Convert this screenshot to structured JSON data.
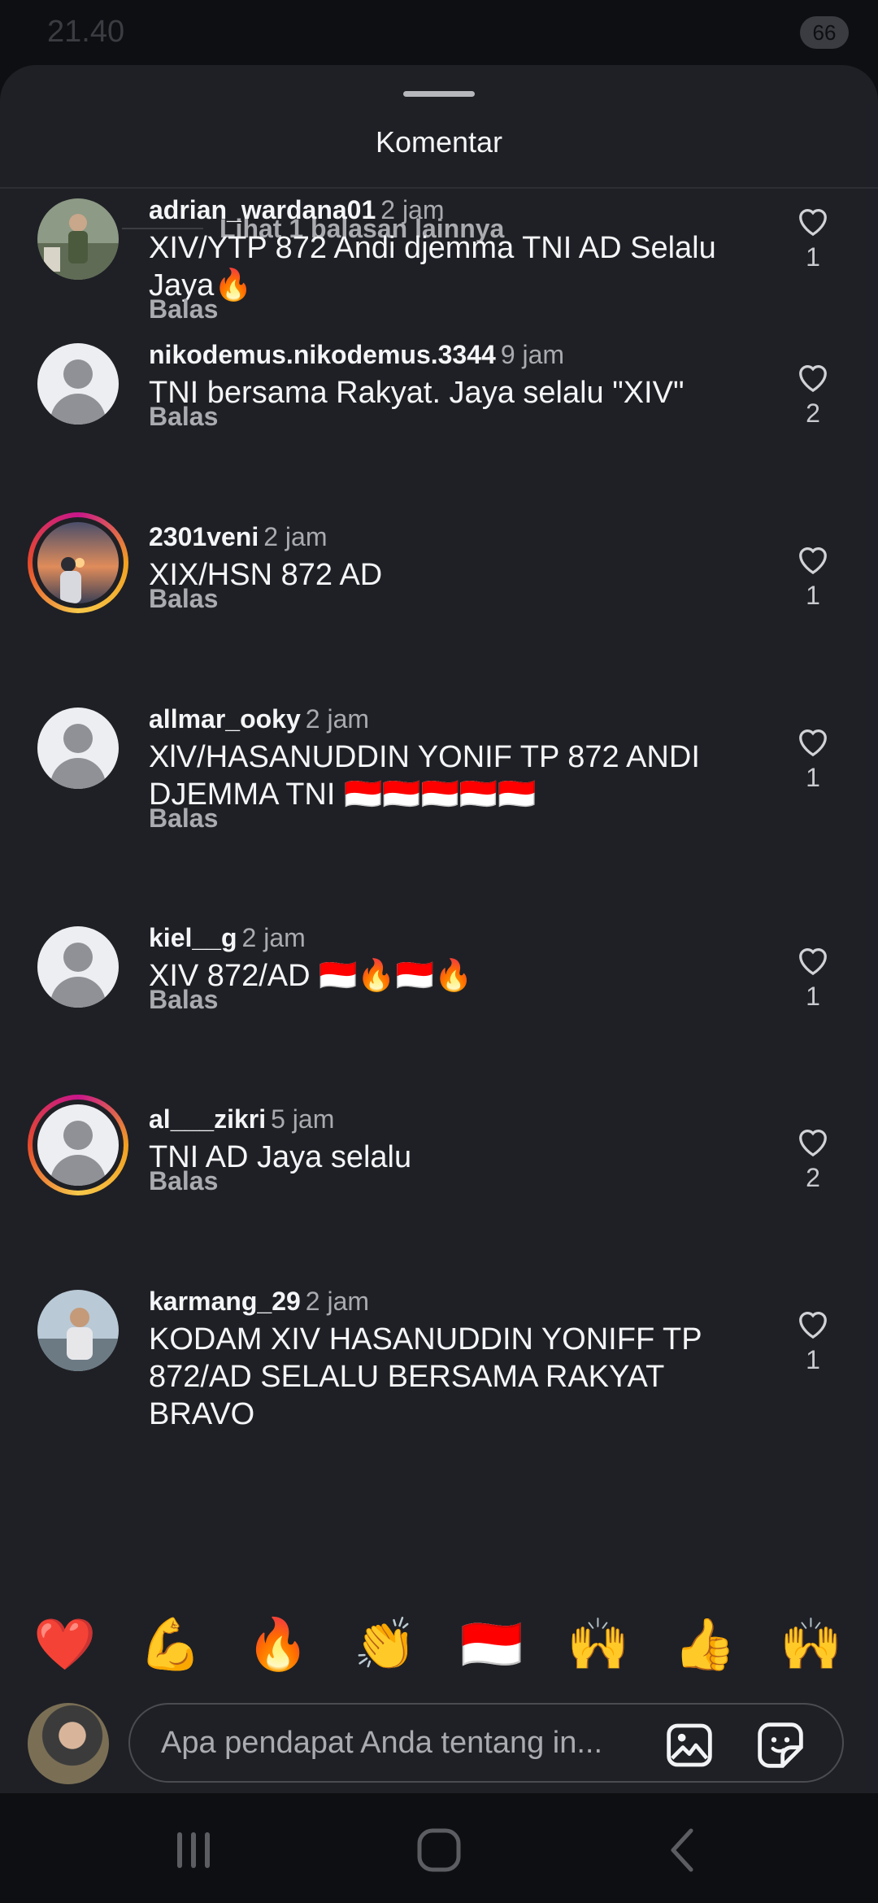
{
  "status_bar": {
    "time": "21.40",
    "battery": "66"
  },
  "sheet": {
    "title": "Komentar",
    "more_replies": "Lihat 1 balasan lainnya"
  },
  "comments": [
    {
      "username": "adrian_wardana01",
      "time": "2 jam",
      "text": "XIV/YTP 872 Andi djemma TNI AD Selalu Jaya🔥",
      "reply": "Balas",
      "likes": "1",
      "avatar": "photo-soldier",
      "ring": false
    },
    {
      "username": "nikodemus.nikodemus.3344",
      "time": "9 jam",
      "text": "TNI bersama Rakyat. Jaya selalu \"XIV\"",
      "reply": "Balas",
      "likes": "2",
      "avatar": "default",
      "ring": false
    },
    {
      "username": "2301veni",
      "time": "2 jam",
      "text": "XIX/HSN 872 AD",
      "reply": "Balas",
      "likes": "1",
      "avatar": "photo-sunset",
      "ring": true
    },
    {
      "username": "allmar_ooky",
      "time": "2 jam",
      "text": "XlV/HASANUDDIN YONIF TP 872 ANDI DJEMMA  TNI 🇮🇩🇮🇩🇮🇩🇮🇩🇮🇩",
      "reply": "Balas",
      "likes": "1",
      "avatar": "default",
      "ring": false
    },
    {
      "username": "kiel__g",
      "time": "2 jam",
      "text": "XIV 872/AD 🇮🇩🔥🇮🇩🔥",
      "reply": "Balas",
      "likes": "1",
      "avatar": "default",
      "ring": false
    },
    {
      "username": "al___zikri",
      "time": "5 jam",
      "text": "TNI AD Jaya selalu",
      "reply": "Balas",
      "likes": "2",
      "avatar": "default",
      "ring": true
    },
    {
      "username": "karmang_29",
      "time": "2 jam",
      "text": "KODAM XIV HASANUDDIN YONIFF TP 872/AD SELALU BERSAMA RAKYAT BRAVO",
      "reply": "",
      "likes": "1",
      "avatar": "photo-man",
      "ring": false
    }
  ],
  "emoji_bar": [
    "❤️",
    "💪",
    "🔥",
    "👏",
    "🇮🇩",
    "🙌",
    "👍",
    "🙌"
  ],
  "composer": {
    "placeholder": "Apa pendapat Anda tentang in..."
  },
  "icons": {
    "like": "heart-outline-icon",
    "gallery": "image-icon",
    "sticker": "sticker-icon"
  },
  "colors": {
    "sheet_bg": "#1f2025",
    "screen_bg": "#0e0f12",
    "ring_start": "#c8168b",
    "ring_end": "#f2a021"
  }
}
